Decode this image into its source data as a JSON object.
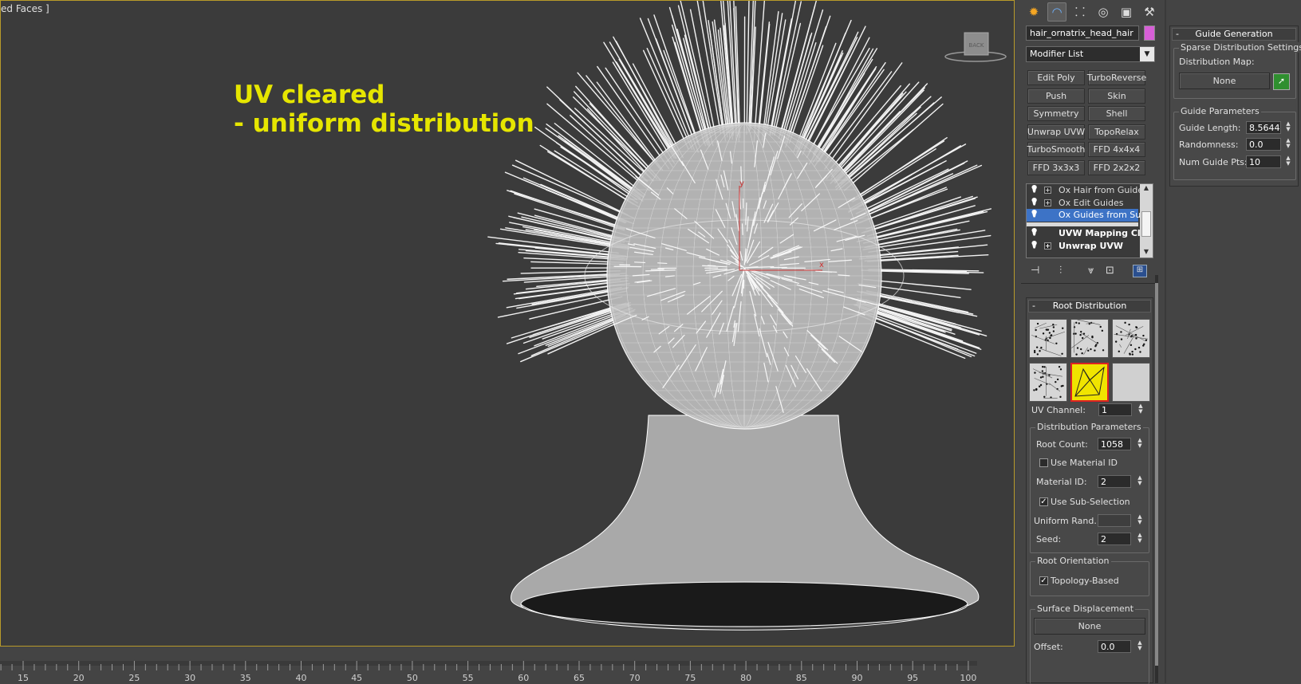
{
  "viewport": {
    "label": "ed Faces ]",
    "annotation_line1": "UV cleared",
    "annotation_line2": "- uniform distribution",
    "viewcube_label": "BACK",
    "axis_x": "x",
    "axis_y": "y"
  },
  "timeline": {
    "ticks": [
      "15",
      "20",
      "25",
      "30",
      "35",
      "40",
      "45",
      "50",
      "55",
      "60",
      "65",
      "70",
      "75",
      "80",
      "85",
      "90",
      "95",
      "100"
    ]
  },
  "command_panel": {
    "tabs": [
      {
        "name": "create-tab",
        "icon": "sun-icon",
        "glyph": "✹"
      },
      {
        "name": "modify-tab",
        "icon": "modify-arc-icon",
        "glyph": "◠"
      },
      {
        "name": "hierarchy-tab",
        "icon": "hierarchy-icon",
        "glyph": "⸬"
      },
      {
        "name": "motion-tab",
        "icon": "motion-icon",
        "glyph": "◎"
      },
      {
        "name": "display-tab",
        "icon": "display-monitor-icon",
        "glyph": "▣"
      },
      {
        "name": "utilities-tab",
        "icon": "hammer-icon",
        "glyph": "⚒"
      }
    ],
    "object_name": "hair_ornatrix_head_hair",
    "object_color": "#d75fd7",
    "modifier_list": "Modifier List",
    "modifier_buttons": [
      [
        "Edit Poly",
        "TurboReverse"
      ],
      [
        "Push",
        "Skin"
      ],
      [
        "Symmetry",
        "Shell"
      ],
      [
        "Unwrap UVW",
        "TopoRelax"
      ],
      [
        "TurboSmooth",
        "FFD 4x4x4"
      ],
      [
        "FFD 3x3x3",
        "FFD 2x2x2"
      ]
    ],
    "stack": [
      {
        "label": "Ox Hair from Guides",
        "expand": true,
        "selected": false,
        "bold": false
      },
      {
        "label": "Ox Edit Guides",
        "expand": true,
        "selected": false,
        "bold": false
      },
      {
        "label": "Ox Guides from Surf",
        "expand": false,
        "selected": true,
        "bold": false
      },
      {
        "label": "UVW Mapping Cle",
        "expand": false,
        "selected": false,
        "bold": true
      },
      {
        "label": "Unwrap UVW",
        "expand": true,
        "selected": false,
        "bold": true
      }
    ]
  },
  "root_distribution": {
    "title": "Root Distribution",
    "uv_channel_label": "UV Channel:",
    "uv_channel": "1",
    "dist_params_title": "Distribution Parameters",
    "root_count_label": "Root Count:",
    "root_count": "1058",
    "use_material_id_label": "Use Material ID",
    "use_material_id": false,
    "material_id_label": "Material ID:",
    "material_id": "2",
    "use_subselection_label": "Use Sub-Selection",
    "use_subselection": true,
    "uniform_rand_label": "Uniform Rand.:",
    "uniform_rand": "",
    "seed_label": "Seed:",
    "seed": "2",
    "root_orientation_title": "Root Orientation",
    "topology_based_label": "Topology-Based",
    "topology_based": true,
    "surface_displacement_title": "Surface Displacement",
    "surface_displacement_map": "None",
    "offset_label": "Offset:",
    "offset": "0.0"
  },
  "guide_generation": {
    "title": "Guide Generation",
    "sparse_title": "Sparse Distribution Settings",
    "distribution_map_label": "Distribution Map:",
    "distribution_map": "None",
    "guide_params_title": "Guide Parameters",
    "guide_length_label": "Guide Length:",
    "guide_length": "8.56445",
    "randomness_label": "Randomness:",
    "randomness": "0.0",
    "num_guide_pts_label": "Num Guide Pts:",
    "num_guide_pts": "10"
  }
}
